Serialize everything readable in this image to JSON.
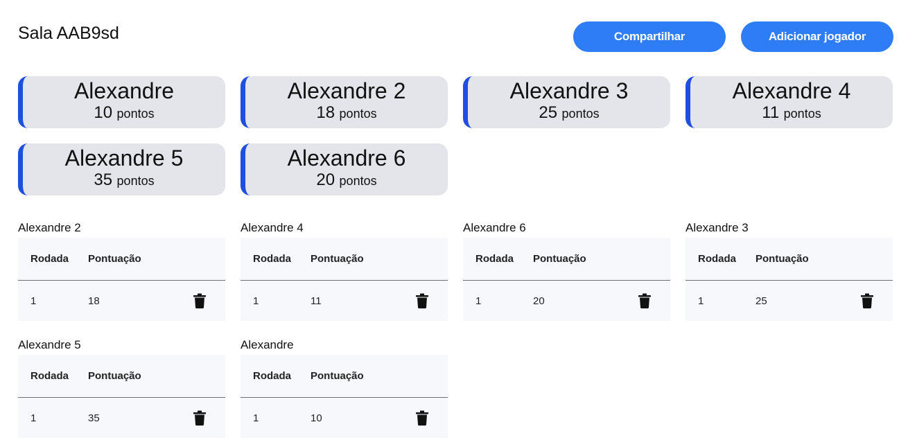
{
  "room": {
    "title": "Sala AAB9sd"
  },
  "actions": {
    "share_label": "Compartilhar",
    "add_player_label": "Adicionar jogador"
  },
  "colors": {
    "accent": "#2f7df6",
    "card_border": "#1f4fe0",
    "card_bg": "#e4e5ea",
    "table_bg": "#f7f8fc"
  },
  "points_unit": "pontos",
  "players": [
    {
      "name": "Alexandre",
      "points": "10"
    },
    {
      "name": "Alexandre 2",
      "points": "18"
    },
    {
      "name": "Alexandre 3",
      "points": "25"
    },
    {
      "name": "Alexandre 4",
      "points": "11"
    },
    {
      "name": "Alexandre 5",
      "points": "35"
    },
    {
      "name": "Alexandre 6",
      "points": "20"
    }
  ],
  "table_headers": {
    "round": "Rodada",
    "score": "Pontuação"
  },
  "delete_icon": "trash-icon",
  "score_tables": [
    {
      "player": "Alexandre 2",
      "rows": [
        {
          "round": "1",
          "score": "18"
        }
      ]
    },
    {
      "player": "Alexandre 4",
      "rows": [
        {
          "round": "1",
          "score": "11"
        }
      ]
    },
    {
      "player": "Alexandre 6",
      "rows": [
        {
          "round": "1",
          "score": "20"
        }
      ]
    },
    {
      "player": "Alexandre 3",
      "rows": [
        {
          "round": "1",
          "score": "25"
        }
      ]
    },
    {
      "player": "Alexandre 5",
      "rows": [
        {
          "round": "1",
          "score": "35"
        }
      ]
    },
    {
      "player": "Alexandre",
      "rows": [
        {
          "round": "1",
          "score": "10"
        }
      ]
    }
  ]
}
